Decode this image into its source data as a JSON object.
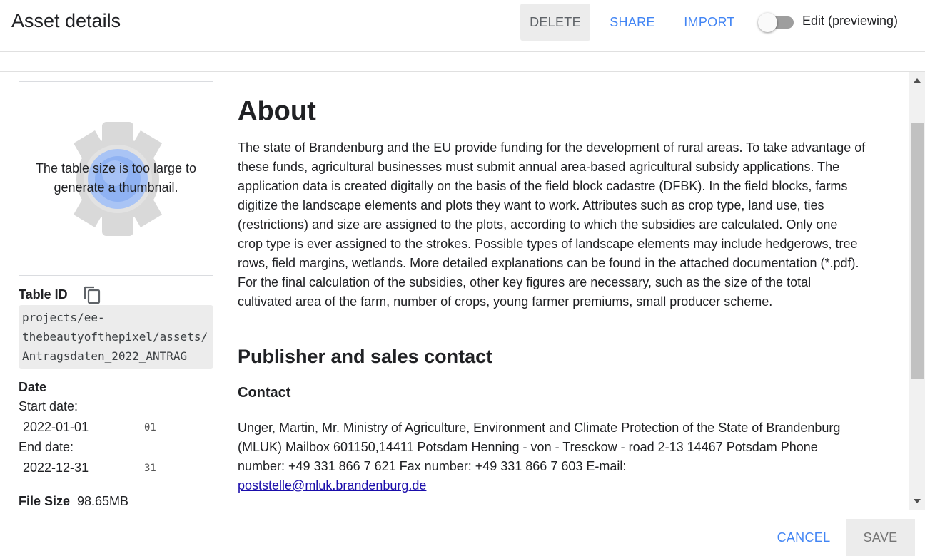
{
  "header": {
    "title": "Asset details",
    "delete_label": "DELETE",
    "share_label": "SHARE",
    "import_label": "IMPORT",
    "edit_toggle_label": "Edit (previewing)",
    "edit_toggle_on": false
  },
  "sidebar": {
    "thumbnail_message": "The table size is too large to generate a thumbnail.",
    "table_id_label": "Table ID",
    "table_id_lines": [
      "projects/ee-",
      "thebeautyofthepixel/assets/",
      "Antragsdaten_2022_ANTRAG"
    ],
    "date_label": "Date",
    "start_date_label": "Start date:",
    "start_date_value": "2022-01-01",
    "start_date_ghost": "01",
    "end_date_label": "End date:",
    "end_date_value": "2022-12-31",
    "end_date_ghost": "31",
    "file_size_label": "File Size",
    "file_size_value": "98.65MB"
  },
  "main": {
    "about_heading": "About",
    "about_text": "The state of Brandenburg and the EU provide funding for the development of rural areas. To take advantage of these funds, agricultural businesses must submit annual area-based agricultural subsidy applications. The application data is created digitally on the basis of the field block cadastre (DFBK). In the field blocks, farms digitize the landscape elements and plots they want to work. Attributes such as crop type, land use, ties (restrictions) and size are assigned to the plots, according to which the subsidies are calculated. Only one crop type is ever assigned to the strokes. Possible types of landscape elements may include hedgerows, tree rows, field margins, wetlands. More detailed explanations can be found in the attached documentation (*.pdf). For the final calculation of the subsidies, other key figures are necessary, such as the size of the total cultivated area of the farm, number of crops, young farmer premiums, small producer scheme.",
    "publisher_heading": "Publisher and sales contact",
    "contact_heading": "Contact",
    "contact_text": "Unger, Martin, Mr. Ministry of Agriculture, Environment and Climate Protection of the State of Brandenburg (MLUK) Mailbox 601150,14411 Potsdam Henning - von - Tresckow - road 2-13 14467 Potsdam Phone number: +49 331 866 7 621 Fax number: +49 331 866 7 603 E-mail:",
    "contact_email": "poststelle@mluk.brandenburg.de"
  },
  "footer": {
    "cancel_label": "CANCEL",
    "save_label": "SAVE"
  },
  "colors": {
    "accent": "#4285f4",
    "link": "#1a0dab",
    "button_bg": "#ececec",
    "text": "#202124"
  },
  "icons": [
    "gear-placeholder-icon",
    "copy-icon",
    "scroll-up-icon",
    "scroll-down-icon"
  ]
}
